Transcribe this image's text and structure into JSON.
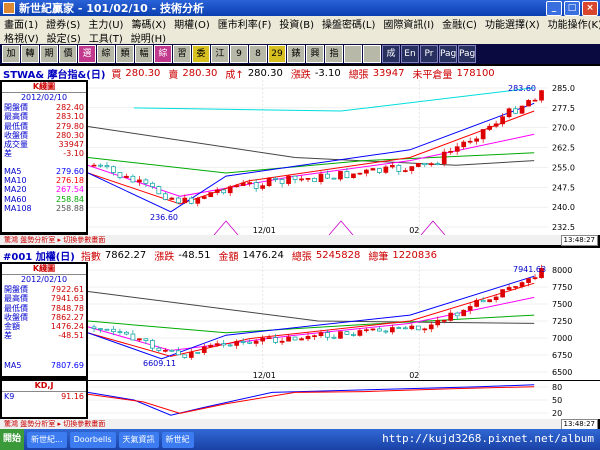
{
  "window": {
    "title": "新世紀贏家 - 101/02/10 - 技術分析"
  },
  "menu": {
    "row1": [
      "畫面(1)",
      "證券(S)",
      "主力(U)",
      "籌碼(X)",
      "期權(O)",
      "匯市利率(F)",
      "投資(B)",
      "操盤密碼(L)",
      "國際資訊(I)",
      "金融(C)",
      "功能選擇(X)",
      "功能操作(K)"
    ],
    "row2": [
      "格視(V)",
      "設定(S)",
      "工具(T)",
      "說明(H)"
    ]
  },
  "toolbar": {
    "buttons": [
      "加",
      "轉",
      "期",
      "價",
      "選",
      "綜",
      "類",
      "幅",
      "綜",
      "習",
      "委",
      "江",
      "9",
      "8",
      "29",
      "錶",
      "興",
      "指",
      "",
      "",
      "成",
      "En",
      "Pr",
      "Page",
      "Page"
    ]
  },
  "top_header": {
    "symbol": "STWA& 摩台指&(日)",
    "buy_label": "買",
    "buy": "280.30",
    "sell_label": "賣",
    "sell": "280.30",
    "deal_label": "成↑",
    "deal": "280.30",
    "change_label": "漲跌",
    "change": "-3.10",
    "volume_label": "總張",
    "volume": "33947",
    "open_int_label": "未平倉量",
    "open_int": "178100"
  },
  "top_panel": {
    "title": "K綫圖",
    "date": "2012/02/10",
    "rows": [
      {
        "k": "開盤價",
        "v": "282.40"
      },
      {
        "k": "最高價",
        "v": "283.10"
      },
      {
        "k": "最低價",
        "v": "279.80"
      },
      {
        "k": "收盤價",
        "v": "280.30"
      },
      {
        "k": "成交量",
        "v": "33947"
      },
      {
        "k": "差",
        "v": "-3.10"
      }
    ],
    "ma": [
      {
        "k": "MA5",
        "v": "279.60",
        "color": "#0000ff"
      },
      {
        "k": "MA10",
        "v": "276.18",
        "color": "#ff0000"
      },
      {
        "k": "MA20",
        "v": "267.54",
        "color": "#ff00ff"
      },
      {
        "k": "MA60",
        "v": "258.84",
        "color": "#00aa00"
      },
      {
        "k": "MA108",
        "v": "258.88",
        "color": "#555555"
      }
    ],
    "axis": [
      "285.0",
      "277.5",
      "270.0",
      "262.5",
      "255.0",
      "247.5",
      "240.0",
      "232.5"
    ],
    "high_label": "283.60",
    "low_label": "236.60",
    "date_ticks": [
      "12/01",
      "02"
    ],
    "strip_text": "驚鴻 盤勢分析室 ▸ 切換參數畫面",
    "time": "13:48:27"
  },
  "bottom_header": {
    "symbol": "#001 加權(日)",
    "index_label": "指數",
    "index": "7862.27",
    "change_label": "漲跌",
    "change": "-48.51",
    "amount_label": "金額",
    "amount": "1476.24",
    "vol_label": "總張",
    "vol": "5245828",
    "count_label": "總筆",
    "count": "1220836"
  },
  "bottom_panel": {
    "title": "K綫圖",
    "date": "2012/02/10",
    "rows": [
      {
        "k": "開盤價",
        "v": "7922.61"
      },
      {
        "k": "最高價",
        "v": "7941.63"
      },
      {
        "k": "最低價",
        "v": "7848.78"
      },
      {
        "k": "收盤價",
        "v": "7862.27"
      },
      {
        "k": "金額",
        "v": "1476.24"
      },
      {
        "k": "差",
        "v": "-48.51"
      }
    ],
    "ma": [
      {
        "k": "MA5",
        "v": "7807.69",
        "color": "#0000ff"
      }
    ],
    "axis": [
      "8000",
      "7750",
      "7500",
      "7250",
      "7000",
      "6750",
      "6500"
    ],
    "high_label": "7941.63",
    "low_label": "6609.11",
    "date_ticks": [
      "12/01",
      "02"
    ],
    "strip_text": "驚鴻 盤勢分析室 ▸ 切換參數畫面",
    "time": "13:48:27"
  },
  "kdj": {
    "title": "KD,J",
    "k_label": "K9",
    "k_value": "91.16",
    "axis": [
      "80",
      "50",
      "20"
    ],
    "strip_text": "驚鴻 盤勢分析室 ▸ 切換參數畫面",
    "time": "13:48:27"
  },
  "taskbar": {
    "start": "開始",
    "tasks": [
      "新世紀...",
      "Doorbells",
      "天氣資訊",
      "新世紀"
    ]
  },
  "watermark": "http://kujd3268.pixnet.net/album"
}
